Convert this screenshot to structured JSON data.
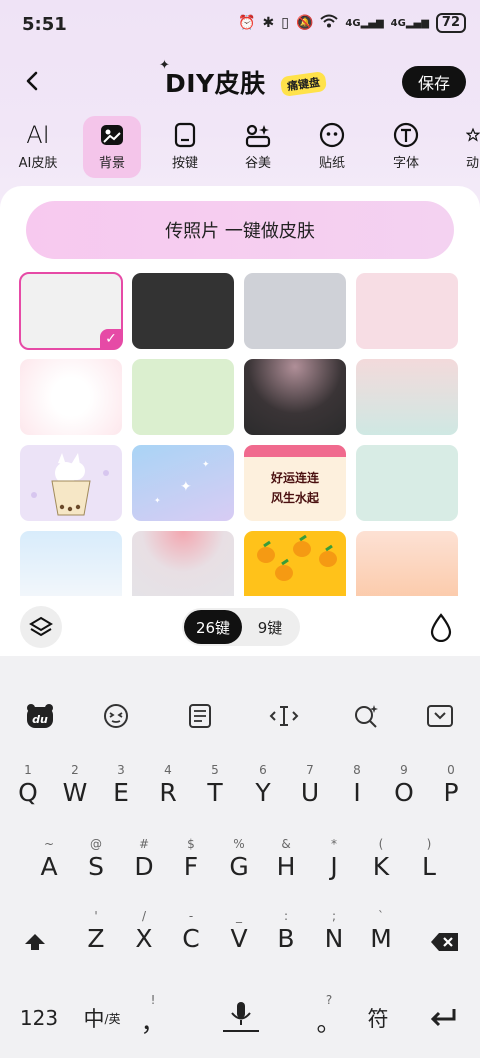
{
  "status_bar": {
    "time": "5:51",
    "battery": "72",
    "signal_1": "4G",
    "signal_2": "4G"
  },
  "header": {
    "title": "DIY皮肤",
    "badge": "痛键盘",
    "save_label": "保存"
  },
  "tabs": [
    {
      "label": "AI皮肤",
      "icon": "ai-icon",
      "icon_text": "AI"
    },
    {
      "label": "背景",
      "icon": "image-icon"
    },
    {
      "label": "按键",
      "icon": "key-icon"
    },
    {
      "label": "谷美",
      "icon": "shapes-icon"
    },
    {
      "label": "贴纸",
      "icon": "sticker-icon"
    },
    {
      "label": "字体",
      "icon": "font-icon",
      "icon_text": "T"
    },
    {
      "label": "动",
      "icon": "star-icon"
    }
  ],
  "active_tab": "背景",
  "cta_label": "传照片 一键做皮肤",
  "background_tile_texts": {
    "tile_11_top": "好运连连",
    "tile_11_bottom": "风生水起"
  },
  "keyboard_bar": {
    "mode_26": "26键",
    "mode_9": "9键"
  },
  "keyboard": {
    "row1": [
      {
        "key": "Q",
        "sup": "1"
      },
      {
        "key": "W",
        "sup": "2"
      },
      {
        "key": "E",
        "sup": "3"
      },
      {
        "key": "R",
        "sup": "4"
      },
      {
        "key": "T",
        "sup": "5"
      },
      {
        "key": "Y",
        "sup": "6"
      },
      {
        "key": "U",
        "sup": "7"
      },
      {
        "key": "I",
        "sup": "8"
      },
      {
        "key": "O",
        "sup": "9"
      },
      {
        "key": "P",
        "sup": "0"
      }
    ],
    "row2": [
      {
        "key": "A",
        "sup": "~"
      },
      {
        "key": "S",
        "sup": "@"
      },
      {
        "key": "D",
        "sup": "#"
      },
      {
        "key": "F",
        "sup": "$"
      },
      {
        "key": "G",
        "sup": "%"
      },
      {
        "key": "H",
        "sup": "&"
      },
      {
        "key": "J",
        "sup": "*"
      },
      {
        "key": "K",
        "sup": "("
      },
      {
        "key": "L",
        "sup": ")"
      }
    ],
    "row3": [
      {
        "key": "Z",
        "sup": "'"
      },
      {
        "key": "X",
        "sup": "/"
      },
      {
        "key": "C",
        "sup": "-"
      },
      {
        "key": "V",
        "sup": "_"
      },
      {
        "key": "B",
        "sup": ":"
      },
      {
        "key": "N",
        "sup": ";"
      },
      {
        "key": "M",
        "sup": "`"
      }
    ],
    "bottom": {
      "num": "123",
      "lang_main": "中",
      "lang_sub": "/英",
      "comma": "，",
      "comma_sup": "!",
      "period": "。",
      "period_sup": "?",
      "symbol": "符"
    }
  },
  "colors": {
    "accent_pink": "#e64aa6",
    "header_bg": "#efe3f6",
    "cta_bg": "#f7c9ef"
  }
}
